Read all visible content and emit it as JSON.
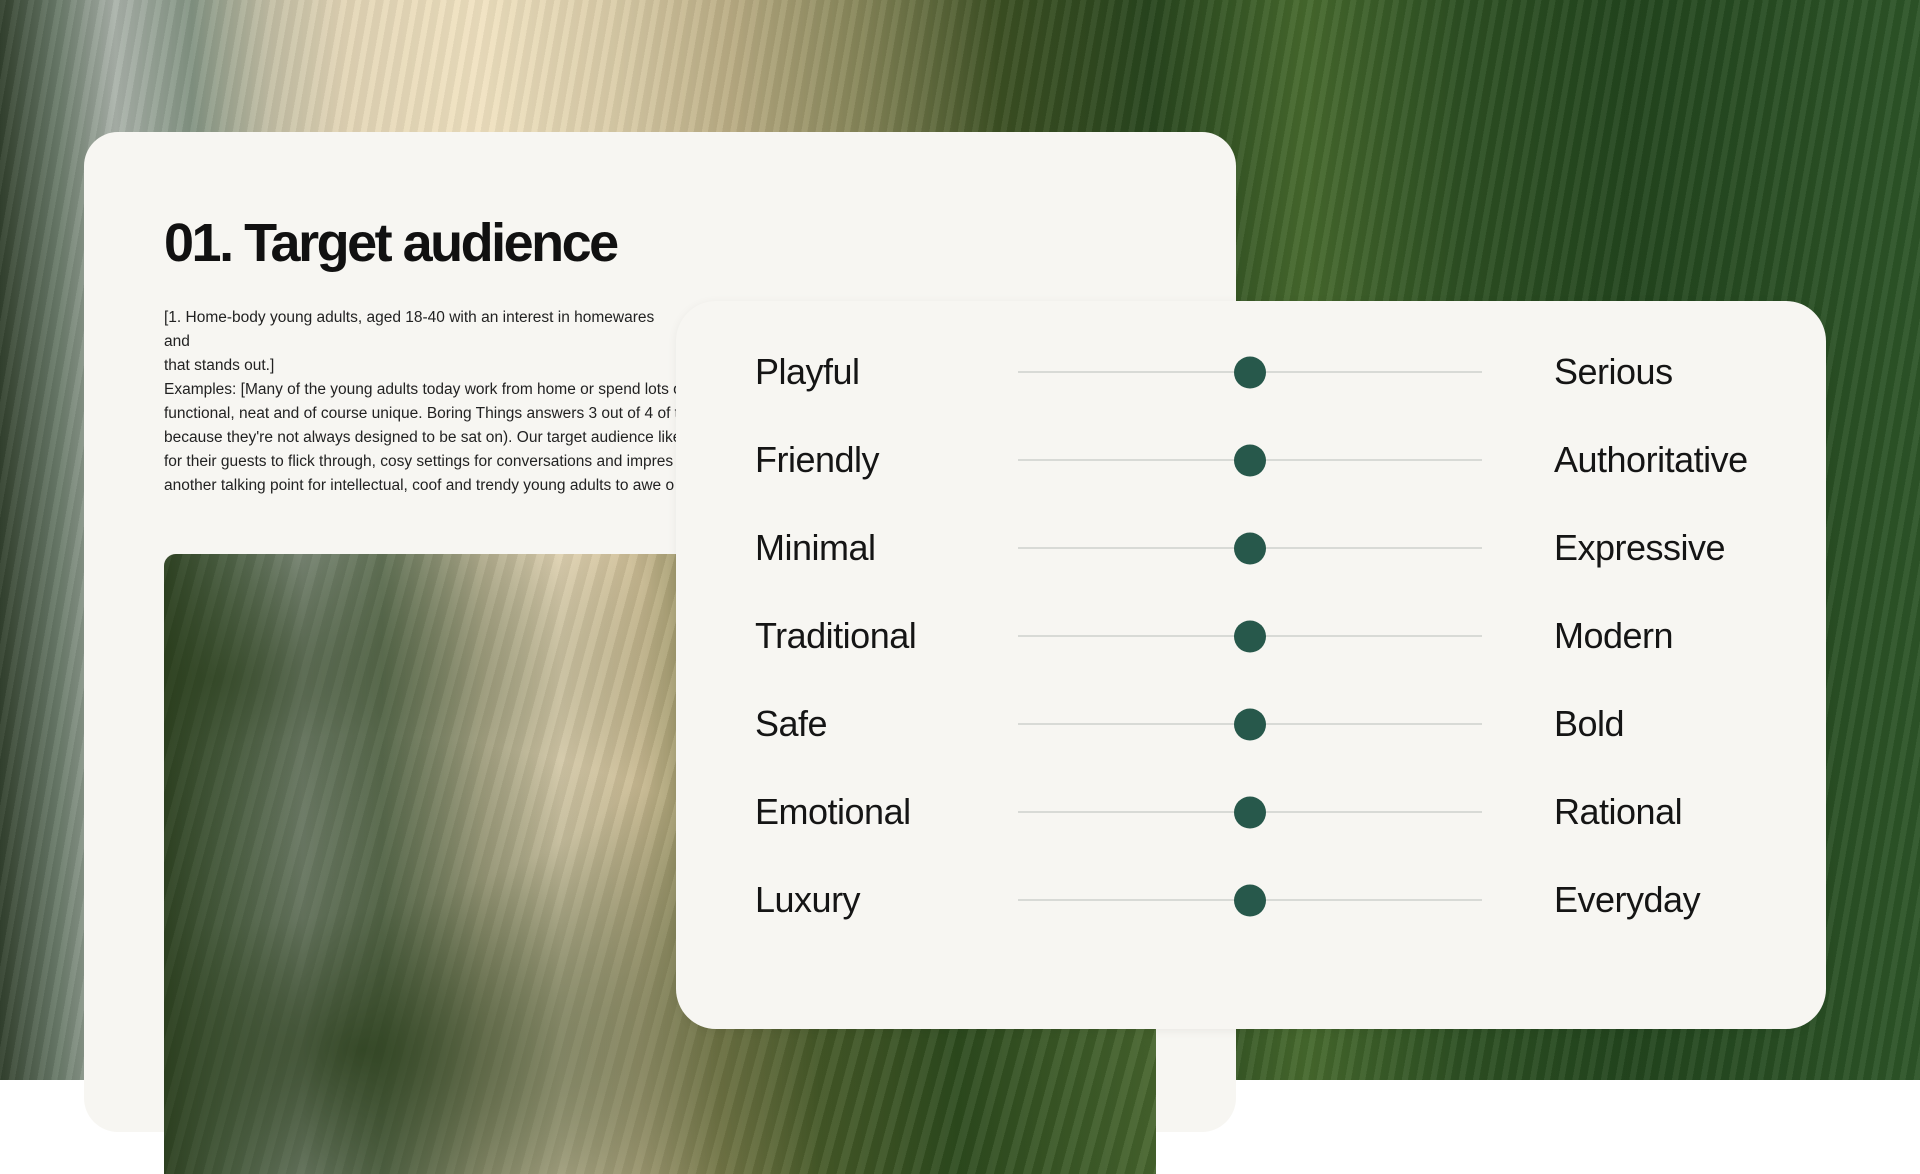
{
  "brief": {
    "title": "01. Target audience",
    "paragraph_1": "[1. Home-body young adults, aged 18-40 with an interest in homewares and",
    "paragraph_1_end": "that stands out.]",
    "paragraph_2_lines": [
      "Examples: [Many of the young adults today work from home or spend lots o",
      "functional, neat and of course unique. Boring Things answers 3 out of 4 of t",
      "because they're not always designed to be sat on). Our target audience like",
      "for their guests to flick through, cosy settings for conversations and impres",
      "another talking point for intellectual, coof and trendy young adults to awe o"
    ]
  },
  "tone_scales": [
    {
      "left": "Playful",
      "right": "Serious",
      "value": 0.5
    },
    {
      "left": "Friendly",
      "right": "Authoritative",
      "value": 0.5
    },
    {
      "left": "Minimal",
      "right": "Expressive",
      "value": 0.5
    },
    {
      "left": "Traditional",
      "right": "Modern",
      "value": 0.5
    },
    {
      "left": "Safe",
      "right": "Bold",
      "value": 0.5
    },
    {
      "left": "Emotional",
      "right": "Rational",
      "value": 0.5
    },
    {
      "left": "Luxury",
      "right": "Everyday",
      "value": 0.5
    }
  ],
  "colors": {
    "card_background": "#f7f6f2",
    "knob": "#27584b",
    "track": "#b9bdb9",
    "text": "#151515"
  }
}
